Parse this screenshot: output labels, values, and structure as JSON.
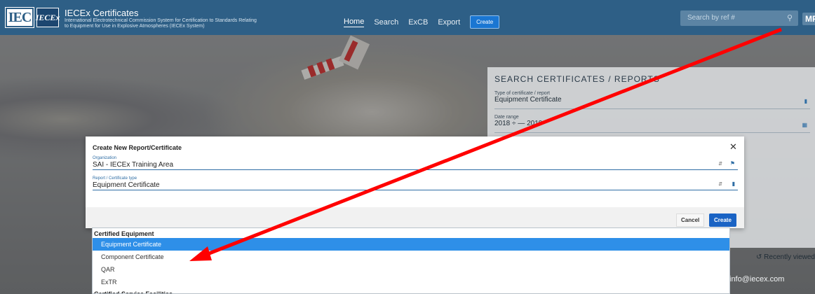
{
  "header": {
    "logo_iec": "IEC",
    "logo_iecex": "IECEx",
    "title": "IECEx Certificates",
    "subtitle": "International Electrotechnical Commission System for Certification to Standards Relating to Equipment for Use in Explosive Atmospheres (IECEx System)",
    "nav": [
      {
        "label": "Home",
        "active": true
      },
      {
        "label": "Search"
      },
      {
        "label": "ExCB"
      },
      {
        "label": "Export"
      }
    ],
    "create_label": "Create",
    "search_placeholder": "Search by ref #",
    "avatar": "MF"
  },
  "search_panel": {
    "title": "SEARCH CERTIFICATES / REPORTS",
    "fields": [
      {
        "label": "Type of certificate / report",
        "value": "Equipment Certificate"
      },
      {
        "label": "Date range",
        "value": "2018 ÷ — 2019"
      }
    ],
    "recently_viewed": "Recently viewed",
    "email": "info@iecex.com"
  },
  "modal": {
    "title": "Create New Report/Certificate",
    "organization_label": "Organization",
    "organization_value": "SAI - IECEx Training Area",
    "type_label": "Report / Certificate type",
    "type_value": "Equipment Certificate",
    "cancel_label": "Cancel",
    "create_label": "Create"
  },
  "dropdown": {
    "group1": "Certified Equipment",
    "items": [
      "Equipment Certificate",
      "Component Certificate",
      "QAR",
      "ExTR"
    ],
    "selected_index": 0,
    "group2": "Certified Service Facilities"
  },
  "colors": {
    "header": "#2e5f86",
    "accent": "#1a63c4",
    "selected": "#2e8fe8",
    "annotation_arrow": "#ff0000"
  }
}
